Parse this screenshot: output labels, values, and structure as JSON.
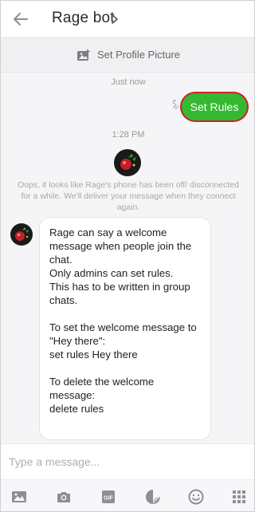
{
  "header": {
    "title": "Rage bot"
  },
  "profile_bar": {
    "label": "Set Profile Picture"
  },
  "chat": {
    "time_just_now": "Just now",
    "sent_message": "Set Rules",
    "time_1": "1:28 PM",
    "offline_note": "Oops, it looks like Rage's phone has been off/ disconnected for a while. We'll deliver your message when they connect again.",
    "bot_message": {
      "line1": "Rage can say a welcome message when people join the chat.",
      "line2": "Only admins can set rules.",
      "line3": "This has to be written in group chats.",
      "line4": "To set the welcome message to \"Hey there\":",
      "line5": "set rules Hey there",
      "line6": "To delete the welcome message:",
      "line7": "delete rules"
    }
  },
  "composer": {
    "placeholder": "Type a message..."
  },
  "colors": {
    "sent_bubble": "#35b832",
    "highlight_ring": "#d12020",
    "icon_gray": "#8e8e96"
  },
  "toolbar": {
    "icons": [
      "gallery-icon",
      "camera-icon",
      "gif-icon",
      "sticker-icon",
      "emoji-icon",
      "more-apps-icon"
    ]
  }
}
